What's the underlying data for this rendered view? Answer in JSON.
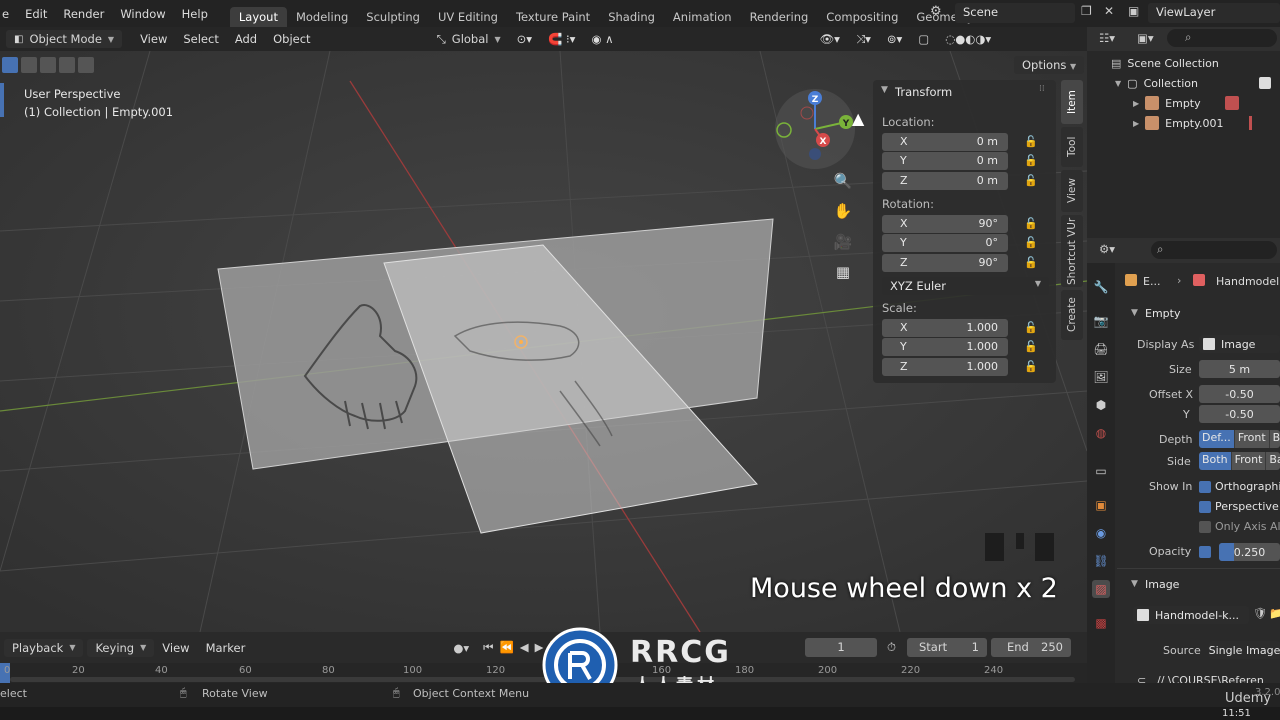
{
  "menu": [
    "e",
    "Edit",
    "Render",
    "Window",
    "Help"
  ],
  "workspaces": [
    "Layout",
    "Modeling",
    "Sculpting",
    "UV Editing",
    "Texture Paint",
    "Shading",
    "Animation",
    "Rendering",
    "Compositing",
    "Geometry Noc"
  ],
  "active_workspace": "Layout",
  "scene": "Scene",
  "view_layer": "ViewLayer",
  "viewport_header": {
    "mode": "Object Mode",
    "menus": [
      "View",
      "Select",
      "Add",
      "Object"
    ],
    "orientation": "Global",
    "options": "Options"
  },
  "viewport_info": {
    "line1": "User Perspective",
    "line2": "(1) Collection | Empty.001"
  },
  "gizmo": {
    "z": "Z",
    "y": "Y",
    "x": "X"
  },
  "caption": "Mouse wheel down x 2",
  "npanel": {
    "title": "Transform",
    "location_label": "Location:",
    "rotation_label": "Rotation:",
    "scale_label": "Scale:",
    "location": [
      {
        "axis": "X",
        "value": "0 m"
      },
      {
        "axis": "Y",
        "value": "0 m"
      },
      {
        "axis": "Z",
        "value": "0 m"
      }
    ],
    "rotation": [
      {
        "axis": "X",
        "value": "90°"
      },
      {
        "axis": "Y",
        "value": "0°"
      },
      {
        "axis": "Z",
        "value": "90°"
      }
    ],
    "rotation_mode": "XYZ Euler",
    "scale": [
      {
        "axis": "X",
        "value": "1.000"
      },
      {
        "axis": "Y",
        "value": "1.000"
      },
      {
        "axis": "Z",
        "value": "1.000"
      }
    ]
  },
  "vtabs": [
    "Item",
    "Tool",
    "View",
    "Shortcut VUr",
    "Create"
  ],
  "outliner": {
    "scene_collection": "Scene Collection",
    "collection": "Collection",
    "items": [
      "Empty",
      "Empty.001"
    ]
  },
  "properties": {
    "breadcrumb_a": "E...",
    "breadcrumb_b": "Handmodel...",
    "empty_panel": "Empty",
    "display_as_label": "Display As",
    "display_as": "Image",
    "size_label": "Size",
    "size": "5 m",
    "offset_x_label": "Offset X",
    "offset_x": "-0.50",
    "offset_y_label": "Y",
    "offset_y": "-0.50",
    "depth_label": "Depth",
    "depth_opts": [
      "Def...",
      "Front",
      "Back"
    ],
    "side_label": "Side",
    "side_opts": [
      "Both",
      "Front",
      "Back"
    ],
    "show_in_label": "Show In",
    "orthographic": "Orthographic",
    "perspective": "Perspective",
    "only_axis": "Only Axis Al...",
    "opacity_label": "Opacity",
    "opacity": "0.250",
    "opacity_fraction": 0.25,
    "image_panel": "Image",
    "image_name": "Handmodel-k...",
    "source_label": "Source",
    "source": "Single Image",
    "path": "// \\COURSE\\Referen"
  },
  "timeline": {
    "menus": [
      "Playback",
      "Keying",
      "View",
      "Marker"
    ],
    "current_frame": "1",
    "start_label": "Start",
    "start": "1",
    "end_label": "End",
    "end": "250",
    "ticks": [
      "0",
      "20",
      "40",
      "60",
      "80",
      "100",
      "120",
      "140",
      "160",
      "180",
      "200",
      "220",
      "240"
    ]
  },
  "status": {
    "left": "elect",
    "middle": "Rotate View",
    "right": "Object Context Menu",
    "version": "3.2.0",
    "brand": "Udemy",
    "time": "11:51"
  },
  "watermark": {
    "title": "RRCG",
    "subtitle": "人人素材"
  }
}
